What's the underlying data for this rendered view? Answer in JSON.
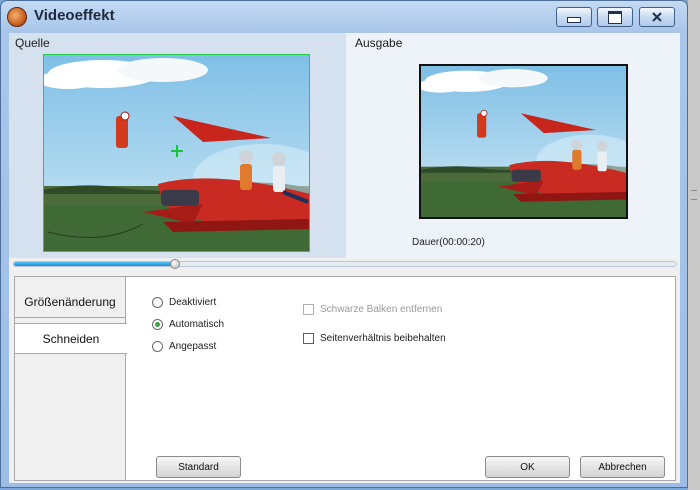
{
  "window": {
    "title": "Videoeffekt",
    "icon": "app-icon",
    "controls": [
      "minimize-icon",
      "maximize-icon",
      "close-icon"
    ]
  },
  "preview": {
    "source_label": "Quelle",
    "output_label": "Ausgabe",
    "duration": "Dauer(00:00:20)",
    "seek_progress": 0.24
  },
  "settings": {
    "tabs": [
      {
        "label": "Größenänderung"
      },
      {
        "label": "Schneiden",
        "selected": true
      }
    ],
    "radio_options": [
      {
        "label": "Deaktiviert",
        "checked": false
      },
      {
        "label": "Automatisch",
        "checked": true
      },
      {
        "label": "Angepasst",
        "checked": false
      }
    ],
    "checkboxes": [
      {
        "label": "Schwarze Balken entfernen",
        "checked": false,
        "enabled": false
      },
      {
        "label": "Seitenverhältnis beibehalten",
        "checked": false,
        "enabled": true
      }
    ]
  },
  "buttons": {
    "standard": "Standard",
    "ok": "OK",
    "cancel": "Abbrechen"
  },
  "colors": {
    "accent": "#1b8fd4",
    "crop_guide": "#22cc44",
    "radio_selected": "#3aa43a"
  }
}
